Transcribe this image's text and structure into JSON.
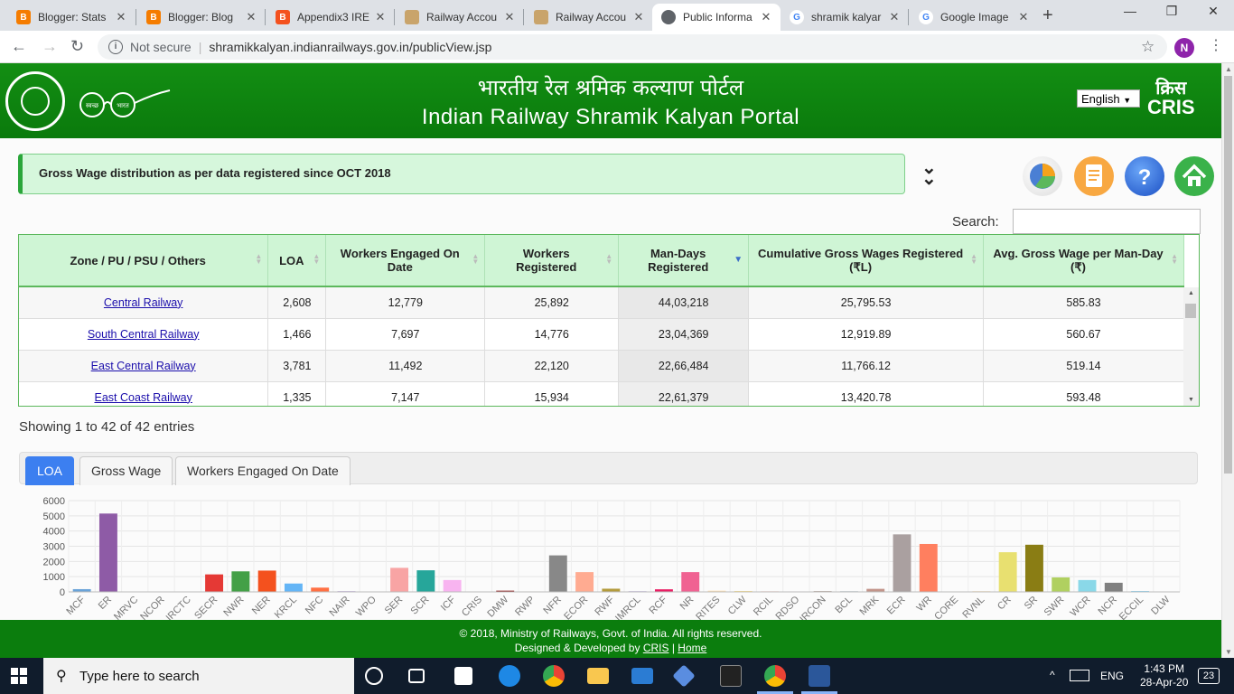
{
  "browser": {
    "tabs": [
      {
        "title": "Blogger: Stats",
        "icon": "blogger-icon"
      },
      {
        "title": "Blogger: Blog",
        "icon": "blogger-icon"
      },
      {
        "title": "Appendix3 IRE",
        "icon": "blogger-icon"
      },
      {
        "title": "Railway Accou",
        "icon": "railway-icon"
      },
      {
        "title": "Railway Accou",
        "icon": "railway-icon"
      },
      {
        "title": "Public Informa",
        "icon": "globe-icon"
      },
      {
        "title": "shramik kalyar",
        "icon": "google-icon"
      },
      {
        "title": "Google Image",
        "icon": "google-icon"
      }
    ],
    "not_secure": "Not secure",
    "url": "shramikkalyan.indianrailways.gov.in/publicView.jsp",
    "profile_initial": "N"
  },
  "header": {
    "hindi_title": "भारतीय रेल श्रमिक कल्याण पोर्टल",
    "english_title": "Indian Railway Shramik Kalyan Portal",
    "language": "English",
    "cris_hindi": "क्रिस",
    "cris": "CRIS",
    "swachh_left": "स्वच्छ",
    "swachh_right": "भारत"
  },
  "info_text": "Gross Wage distribution as per data registered since OCT 2018",
  "search_label": "Search:",
  "table": {
    "headers": [
      "Zone / PU / PSU / Others",
      "LOA",
      "Workers Engaged On Date",
      "Workers Registered",
      "Man-Days Registered",
      "Cumulative Gross Wages Registered (₹L)",
      "Avg. Gross Wage per Man-Day (₹)"
    ],
    "rows": [
      {
        "zone": "Central Railway",
        "loa": "2,608",
        "engaged": "12,779",
        "registered": "25,892",
        "mandays": "44,03,218",
        "wages": "25,795.53",
        "avg": "585.83"
      },
      {
        "zone": "South Central Railway",
        "loa": "1,466",
        "engaged": "7,697",
        "registered": "14,776",
        "mandays": "23,04,369",
        "wages": "12,919.89",
        "avg": "560.67"
      },
      {
        "zone": "East Central Railway",
        "loa": "3,781",
        "engaged": "11,492",
        "registered": "22,120",
        "mandays": "22,66,484",
        "wages": "11,766.12",
        "avg": "519.14"
      },
      {
        "zone": "East Coast Railway",
        "loa": "1,335",
        "engaged": "7,147",
        "registered": "15,934",
        "mandays": "22,61,379",
        "wages": "13,420.78",
        "avg": "593.48"
      }
    ]
  },
  "showing_text": "Showing 1 to 42 of 42 entries",
  "chart_tabs": [
    "LOA",
    "Gross Wage",
    "Workers Engaged On Date"
  ],
  "chart_data": {
    "type": "bar",
    "title": "",
    "xlabel": "",
    "ylabel": "",
    "ylim": [
      0,
      6000
    ],
    "yticks": [
      0,
      1000,
      2000,
      3000,
      4000,
      5000,
      6000
    ],
    "categories": [
      "MCF",
      "ER",
      "MRVC",
      "NCOR",
      "IRCTC",
      "SECR",
      "NWR",
      "NER",
      "KRCL",
      "NFC",
      "NAIR",
      "WPO",
      "SER",
      "SCR",
      "ICF",
      "CRIS",
      "DMW",
      "RWP",
      "NFR",
      "ECOR",
      "RWF",
      "IMRCL",
      "RCF",
      "NR",
      "RITES",
      "CLW",
      "RCIL",
      "RDSO",
      "IRCON",
      "BCL",
      "MRK",
      "ECR",
      "WR",
      "CORE",
      "RVNL",
      "CR",
      "SR",
      "SWR",
      "WCR",
      "NCR",
      "ECCIL",
      "DLW"
    ],
    "values": [
      180,
      5150,
      20,
      10,
      10,
      1150,
      1350,
      1400,
      550,
      280,
      40,
      10,
      1580,
      1420,
      780,
      20,
      80,
      30,
      2400,
      1300,
      210,
      40,
      170,
      1300,
      80,
      60,
      40,
      30,
      50,
      40,
      200,
      3781,
      3150,
      30,
      40,
      2608,
      3100,
      950,
      780,
      600,
      50,
      20
    ],
    "colors": [
      "#6aa3d8",
      "#8e5ba6",
      "#4fb8a0",
      "#e9a0c0",
      "#f0b070",
      "#e53935",
      "#43a047",
      "#f4511e",
      "#64b5f6",
      "#ff7043",
      "#7e57c2",
      "#ab47bc",
      "#f8a4a4",
      "#26a69a",
      "#f8b4f0",
      "#b39ddb",
      "#8d1c1c",
      "#fbc02d",
      "#888888",
      "#ffab91",
      "#b39b3c",
      "#9575cd",
      "#e91e63",
      "#f06292",
      "#ffe0b2",
      "#ffe082",
      "#ffccbc",
      "#e1bee7",
      "#a1887f",
      "#90a4ae",
      "#c2948a",
      "#aaa0a0",
      "#ff7f5f",
      "#c5e1a5",
      "#ffd180",
      "#e8e070",
      "#8a7d14",
      "#b0d060",
      "#8ad8e8",
      "#808080",
      "#4fc3f7",
      "#b3e5fc"
    ]
  },
  "footer": {
    "line1": "© 2018, Ministry of Railways, Govt. of India. All rights reserved.",
    "designed_by": "Designed & Developed by",
    "cris_link": "CRIS",
    "home_link": "Home"
  },
  "taskbar": {
    "search_placeholder": "Type here to search",
    "lang": "ENG",
    "time": "1:43 PM",
    "date": "28-Apr-20",
    "notif_count": "23"
  }
}
